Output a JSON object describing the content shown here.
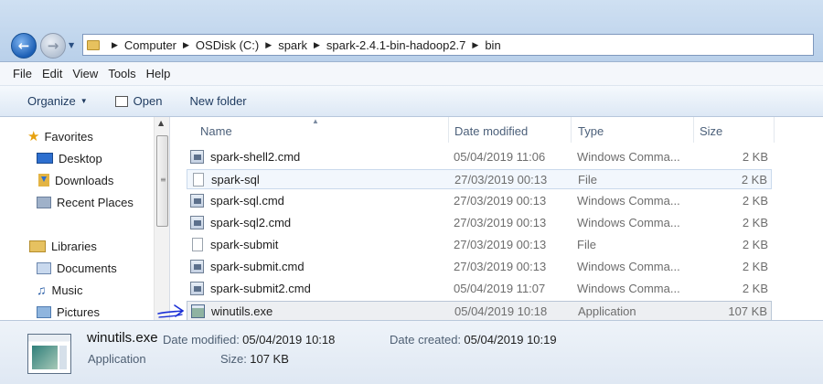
{
  "address": {
    "crumbs": [
      "Computer",
      "OSDisk (C:)",
      "spark",
      "spark-2.4.1-bin-hadoop2.7",
      "bin"
    ]
  },
  "menu": [
    "File",
    "Edit",
    "View",
    "Tools",
    "Help"
  ],
  "toolbar": {
    "organize": "Organize",
    "open": "Open",
    "new_folder": "New folder"
  },
  "nav": {
    "favorites": "Favorites",
    "desktop": "Desktop",
    "downloads": "Downloads",
    "recent": "Recent Places",
    "libraries": "Libraries",
    "documents": "Documents",
    "music": "Music",
    "pictures": "Pictures"
  },
  "columns": {
    "name": "Name",
    "date": "Date modified",
    "type": "Type",
    "size": "Size"
  },
  "files": [
    {
      "name": "spark-shell2.cmd",
      "date": "05/04/2019 11:06",
      "type": "Windows Comma...",
      "size": "2 KB",
      "icon": "cmd-icon"
    },
    {
      "name": "spark-sql",
      "date": "27/03/2019 00:13",
      "type": "File",
      "size": "2 KB",
      "icon": "file-icon"
    },
    {
      "name": "spark-sql.cmd",
      "date": "27/03/2019 00:13",
      "type": "Windows Comma...",
      "size": "2 KB",
      "icon": "cmd-icon"
    },
    {
      "name": "spark-sql2.cmd",
      "date": "27/03/2019 00:13",
      "type": "Windows Comma...",
      "size": "2 KB",
      "icon": "cmd-icon"
    },
    {
      "name": "spark-submit",
      "date": "27/03/2019 00:13",
      "type": "File",
      "size": "2 KB",
      "icon": "file-icon"
    },
    {
      "name": "spark-submit.cmd",
      "date": "27/03/2019 00:13",
      "type": "Windows Comma...",
      "size": "2 KB",
      "icon": "cmd-icon"
    },
    {
      "name": "spark-submit2.cmd",
      "date": "05/04/2019 11:07",
      "type": "Windows Comma...",
      "size": "2 KB",
      "icon": "cmd-icon"
    },
    {
      "name": "winutils.exe",
      "date": "05/04/2019 10:18",
      "type": "Application",
      "size": "107 KB",
      "icon": "app-icon"
    }
  ],
  "details": {
    "name": "winutils.exe",
    "type": "Application",
    "modified_label": "Date modified:",
    "modified_value": "05/04/2019 10:18",
    "created_label": "Date created:",
    "created_value": "05/04/2019 10:19",
    "size_label": "Size:",
    "size_value": "107 KB"
  },
  "colors": {
    "annotation_arrow": "#1a2fd6"
  }
}
